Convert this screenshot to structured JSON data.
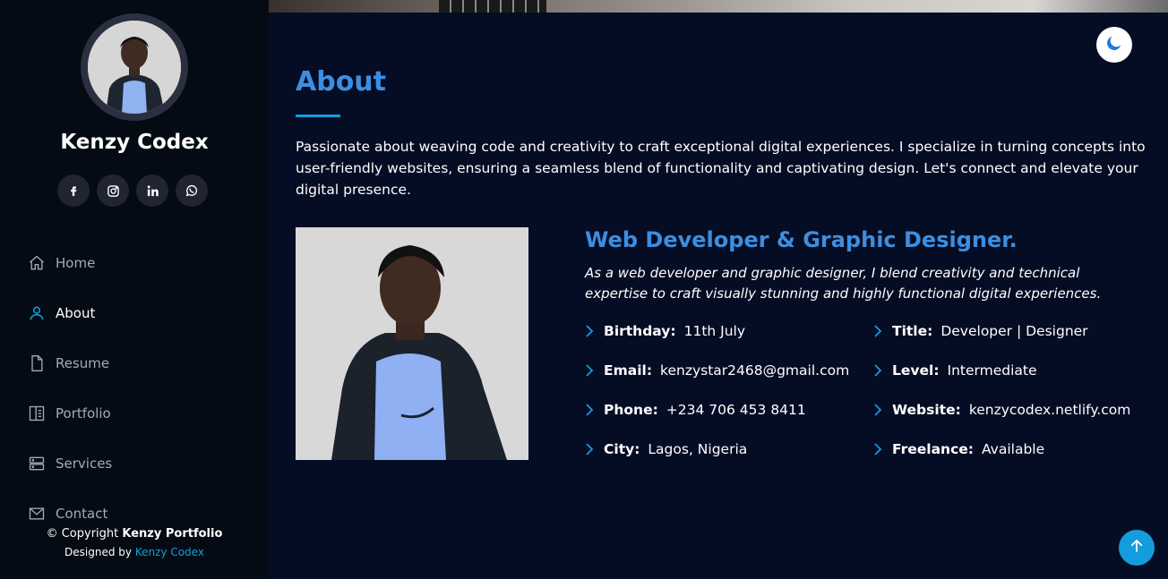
{
  "sidebar": {
    "name": "Kenzy Codex",
    "socials": [
      {
        "icon": "facebook-icon"
      },
      {
        "icon": "instagram-icon"
      },
      {
        "icon": "linkedin-icon"
      },
      {
        "icon": "whatsapp-icon"
      }
    ],
    "nav": [
      {
        "label": "Home",
        "icon": "home-icon",
        "active": false
      },
      {
        "label": "About",
        "icon": "user-icon",
        "active": true
      },
      {
        "label": "Resume",
        "icon": "file-icon",
        "active": false
      },
      {
        "label": "Portfolio",
        "icon": "book-icon",
        "active": false
      },
      {
        "label": "Services",
        "icon": "server-icon",
        "active": false
      },
      {
        "label": "Contact",
        "icon": "envelope-icon",
        "active": false
      }
    ],
    "footer": {
      "copyright_prefix": "© Copyright",
      "copyright_brand": "Kenzy Portfolio",
      "designed_by": "Designed by",
      "designer": "Kenzy Codex"
    }
  },
  "about": {
    "title": "About",
    "intro": "Passionate about weaving code and creativity to craft exceptional digital experiences. I specialize in turning concepts into user-friendly websites, ensuring a seamless blend of functionality and captivating design. Let's connect and elevate your digital presence.",
    "role": "Web Developer & Graphic Designer.",
    "role_desc": "As a web developer and graphic designer, I blend creativity and technical expertise to craft visually stunning and highly functional digital experiences.",
    "facts": [
      {
        "key": "Birthday:",
        "value": "11th July"
      },
      {
        "key": "Title:",
        "value": "Developer | Designer"
      },
      {
        "key": "Email:",
        "value": "kenzystar2468@gmail.com"
      },
      {
        "key": "Level:",
        "value": "Intermediate"
      },
      {
        "key": "Phone:",
        "value": "+234 706 453 8411"
      },
      {
        "key": "Website:",
        "value": "kenzycodex.netlify.com"
      },
      {
        "key": "City:",
        "value": "Lagos, Nigeria"
      },
      {
        "key": "Freelance:",
        "value": "Available"
      }
    ]
  },
  "controls": {
    "theme_toggle_icon": "moon-icon",
    "back_to_top_icon": "arrow-up-icon"
  },
  "colors": {
    "accent": "#149ddd",
    "heading": "#3d8ee0",
    "sidebar_bg": "#040b14",
    "main_bg": "#050d24"
  }
}
